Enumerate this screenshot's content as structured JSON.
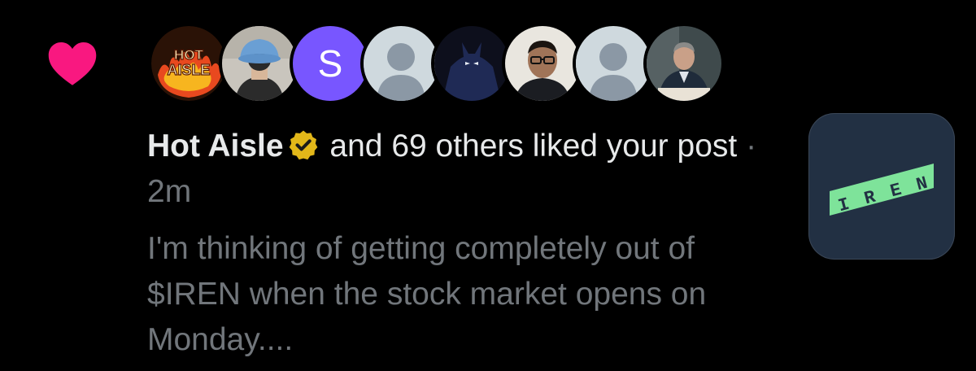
{
  "notification": {
    "type_icon": "heart-icon",
    "accent_color": "#f91880",
    "avatars": [
      {
        "name": "hot-aisle-avatar",
        "logo_text_1": "HOT",
        "logo_text_2": "AISLE"
      },
      {
        "name": "bucket-hat-avatar"
      },
      {
        "name": "letter-s-avatar",
        "initial": "S",
        "color": "#7856ff"
      },
      {
        "name": "default-avatar-1"
      },
      {
        "name": "batman-avatar"
      },
      {
        "name": "glasses-man-avatar"
      },
      {
        "name": "default-avatar-2"
      },
      {
        "name": "suited-man-avatar"
      }
    ],
    "actor_name": "Hot Aisle",
    "verified_icon": "verified-badge-icon",
    "action_text": " and 69 others liked your post",
    "separator": " · ",
    "time": "2m",
    "snippet": "I'm thinking of getting completely out of $IREN when the stock market opens on Monday....",
    "app_thumbnail": {
      "icon": "iren-logo-icon",
      "letters": [
        "I",
        "R",
        "E",
        "N"
      ],
      "bg": "#223043",
      "band": "#7ee39a"
    }
  }
}
